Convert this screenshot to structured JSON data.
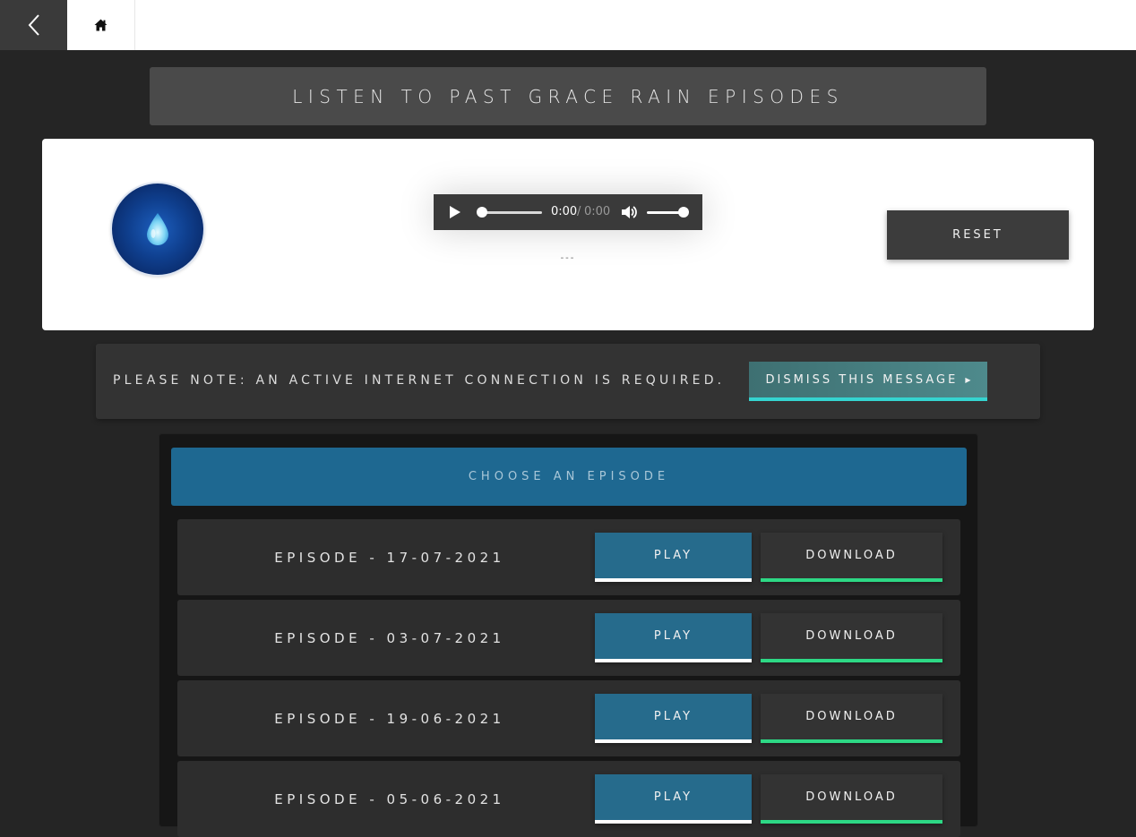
{
  "nav": {
    "back_icon": "chevron-left-icon",
    "home_icon": "home-icon"
  },
  "title": "LISTEN TO PAST GRACE RAIN EPISODES",
  "player": {
    "logo_icon": "water-drop-icon",
    "current_time": "0:00",
    "separator": "/",
    "duration": "0:00",
    "now_playing": "---",
    "progress": 0,
    "volume": 1.0,
    "reset_label": "RESET"
  },
  "notice": {
    "text": "PLEASE NOTE: AN ACTIVE INTERNET CONNECTION IS REQUIRED.",
    "dismiss_label": "DISMISS THIS MESSAGE",
    "dismiss_arrow": "▶"
  },
  "episodes": {
    "header": "CHOOSE AN EPISODE",
    "play_label": "PLAY",
    "download_label": "DOWNLOAD",
    "items": [
      {
        "title": "EPISODE - 17-07-2021"
      },
      {
        "title": "EPISODE - 03-07-2021"
      },
      {
        "title": "EPISODE - 19-06-2021"
      },
      {
        "title": "EPISODE - 05-06-2021"
      }
    ]
  },
  "colors": {
    "page_bg": "#252525",
    "accent_blue": "#1e6891",
    "play_underline": "#ffffff",
    "download_underline": "#2dd885",
    "dismiss_underline": "#35d4d0"
  }
}
